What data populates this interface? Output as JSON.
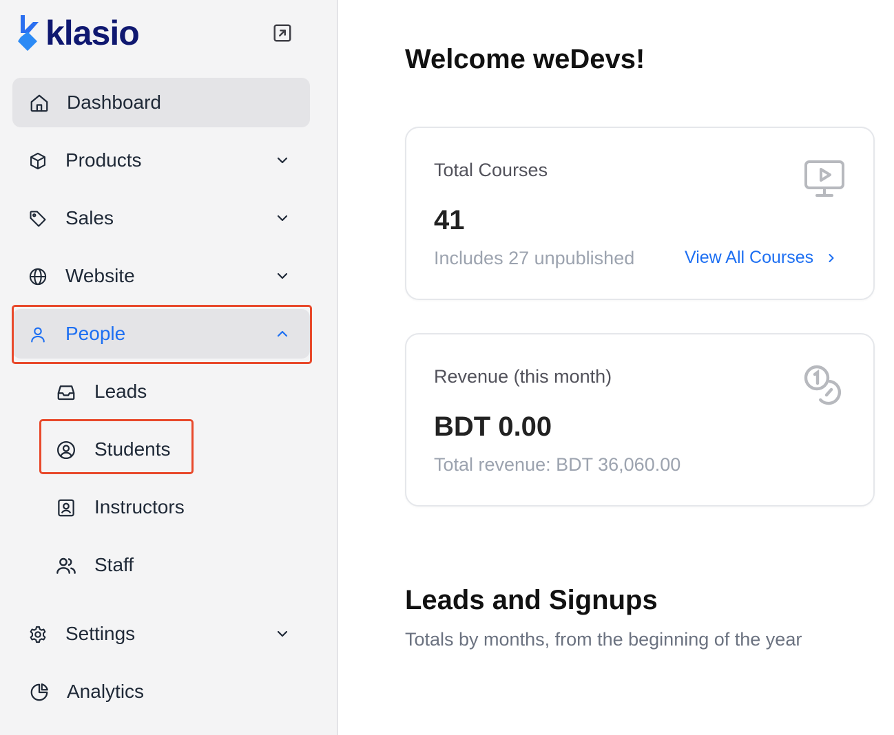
{
  "brand": {
    "name": "klasio",
    "accent": "#1d6ff2",
    "dark": "#0f1870"
  },
  "sidebar": {
    "collapse_icon": "open-in-new-icon",
    "items": [
      {
        "key": "dashboard",
        "label": "Dashboard",
        "icon": "home-icon",
        "active": true
      },
      {
        "key": "products",
        "label": "Products",
        "icon": "cube-icon",
        "chevron": "down"
      },
      {
        "key": "sales",
        "label": "Sales",
        "icon": "tag-icon",
        "chevron": "down"
      },
      {
        "key": "website",
        "label": "Website",
        "icon": "globe-icon",
        "chevron": "down"
      },
      {
        "key": "people",
        "label": "People",
        "icon": "user-icon",
        "chevron": "up",
        "expanded": true,
        "children": [
          {
            "key": "leads",
            "label": "Leads",
            "icon": "inbox-icon"
          },
          {
            "key": "students",
            "label": "Students",
            "icon": "user-circle-icon",
            "highlighted": true
          },
          {
            "key": "instructors",
            "label": "Instructors",
            "icon": "id-badge-icon"
          },
          {
            "key": "staff",
            "label": "Staff",
            "icon": "users-icon"
          }
        ]
      },
      {
        "key": "settings",
        "label": "Settings",
        "icon": "gear-icon",
        "chevron": "down"
      },
      {
        "key": "analytics",
        "label": "Analytics",
        "icon": "pie-chart-icon"
      }
    ]
  },
  "main": {
    "welcome": "Welcome weDevs!",
    "cards": [
      {
        "title": "Total Courses",
        "value": "41",
        "subtitle": "Includes 27 unpublished",
        "link": "View All Courses",
        "icon": "monitor-play-icon"
      },
      {
        "title": "Revenue (this month)",
        "value": "BDT 0.00",
        "subtitle": "Total revenue: BDT 36,060.00",
        "icon": "coins-icon"
      }
    ],
    "leads": {
      "title": "Leads and Signups",
      "subtitle": "Totals by months, from the beginning of the year"
    }
  },
  "highlight_color": "#e8492b"
}
